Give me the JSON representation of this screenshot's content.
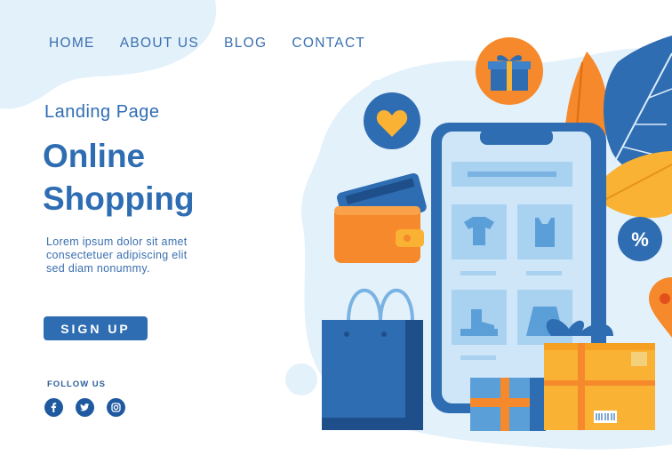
{
  "nav": {
    "items": [
      "HOME",
      "ABOUT US",
      "BLOG",
      "CONTACT"
    ]
  },
  "hero": {
    "subtitle": "Landing Page",
    "title_line1": "Online",
    "title_line2": "Shopping",
    "body_line1": "Lorem ipsum dolor sit amet",
    "body_line2": "consectetuer adipiscing elit",
    "body_line3": "sed diam nonummy.",
    "cta_label": "SIGN UP"
  },
  "social": {
    "heading": "FOLLOW US",
    "icons": [
      "facebook-icon",
      "twitter-icon",
      "instagram-icon"
    ]
  },
  "illustration": {
    "discount_badge": "%",
    "colors": {
      "primary": "#2f6db3",
      "accent": "#f5892b",
      "light": "#dcedfa"
    }
  }
}
